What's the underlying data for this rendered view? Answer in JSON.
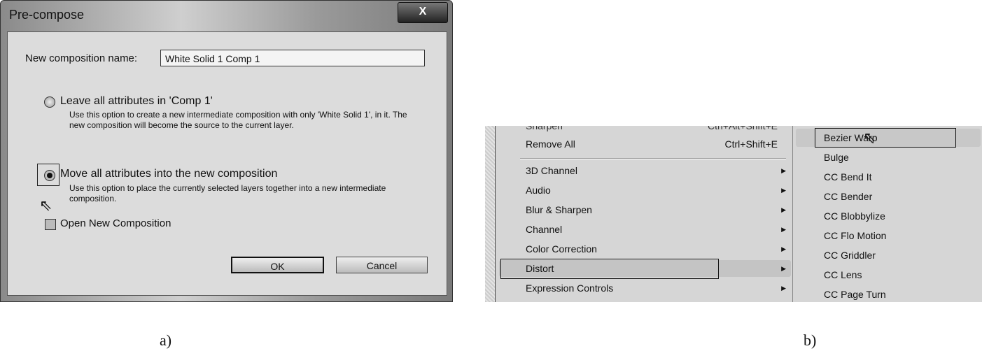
{
  "panel_a": {
    "caption": "a)",
    "title": "Pre-compose",
    "close_label": "X",
    "name_label": "New composition name:",
    "name_value": "White Solid 1 Comp 1",
    "option1": {
      "label": "Leave all attributes in 'Comp 1'",
      "desc": "Use this option to create a new intermediate composition with only 'White Solid 1', in it. The new composition will become the source to the current layer.",
      "selected": false
    },
    "option2": {
      "label": "Move all attributes into the new composition",
      "desc": "Use this option to place the currently selected layers together into a new intermediate composition.",
      "selected": true
    },
    "open_new": {
      "label": "Open New Composition",
      "checked": false
    },
    "ok": "OK",
    "cancel": "Cancel"
  },
  "panel_b": {
    "caption": "b)",
    "menu": [
      {
        "label": "Sharpen",
        "shortcut": "Ctrl+Alt+Shift+E"
      },
      {
        "label": "Remove All",
        "shortcut": "Ctrl+Shift+E"
      },
      {
        "label": "3D Channel",
        "submenu": true
      },
      {
        "label": "Audio",
        "submenu": true
      },
      {
        "label": "Blur & Sharpen",
        "submenu": true
      },
      {
        "label": "Channel",
        "submenu": true
      },
      {
        "label": "Color Correction",
        "submenu": true
      },
      {
        "label": "Distort",
        "submenu": true,
        "highlighted": true
      },
      {
        "label": "Expression Controls",
        "submenu": true
      }
    ],
    "submenu": [
      "Bezier Warp",
      "Bulge",
      "CC Bend It",
      "CC Bender",
      "CC Blobbylize",
      "CC Flo Motion",
      "CC Griddler",
      "CC Lens",
      "CC Page Turn"
    ],
    "arrow": "▶"
  }
}
